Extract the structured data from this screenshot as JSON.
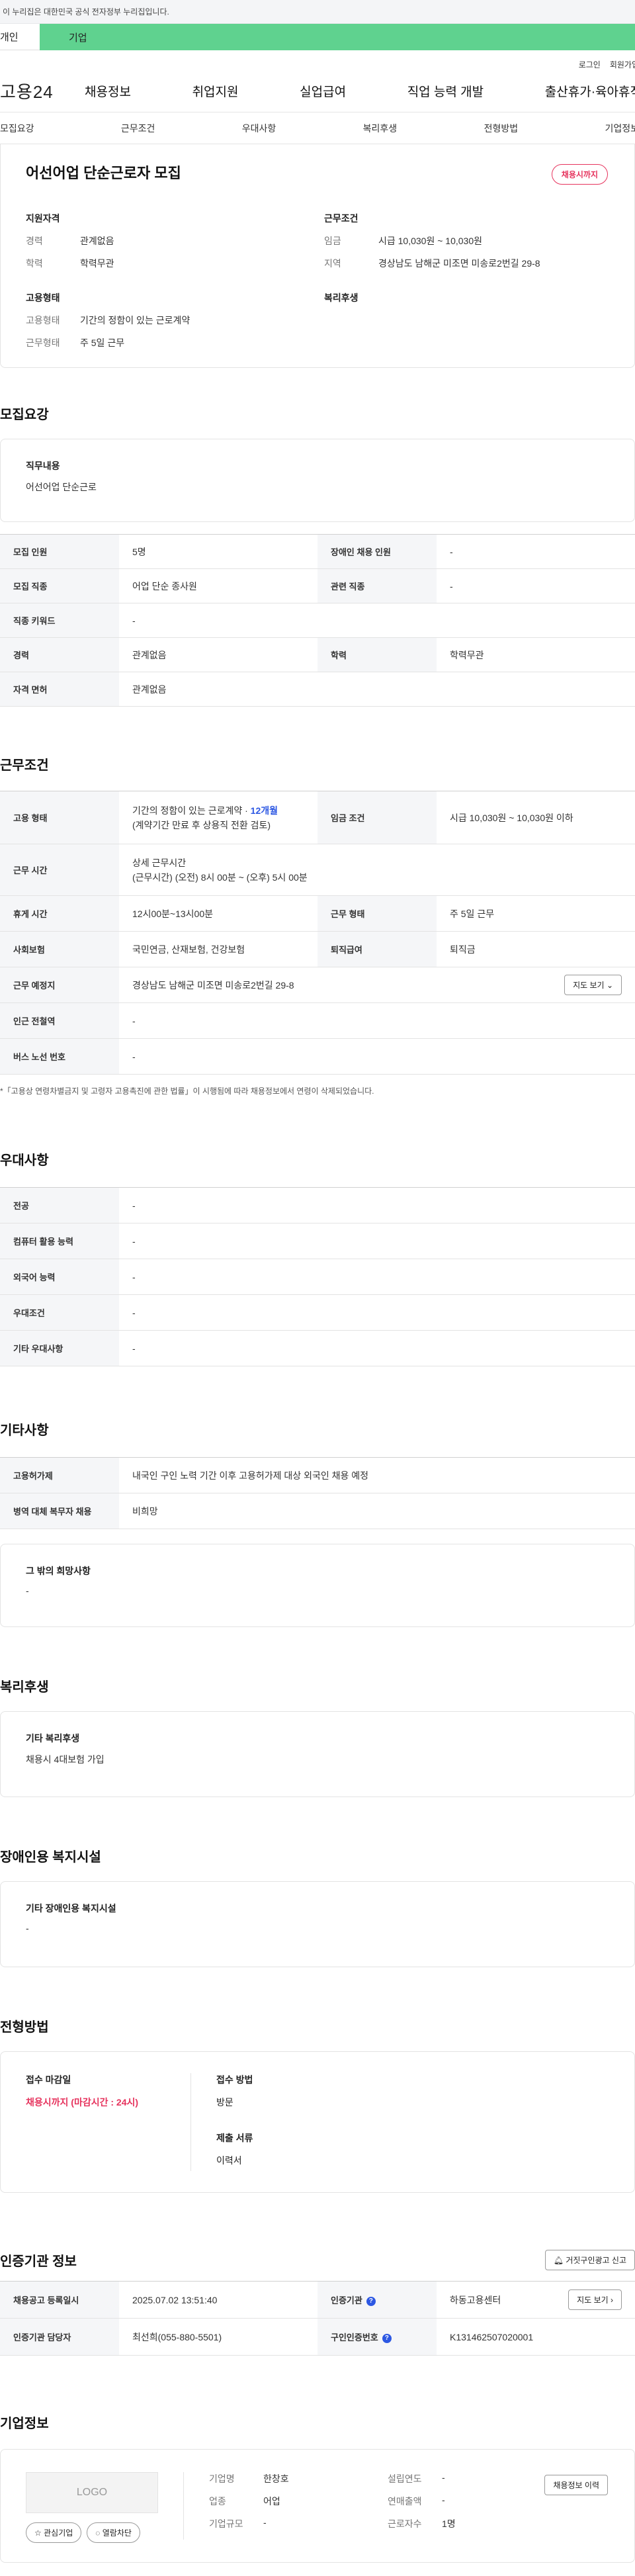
{
  "gov_banner": "이 누리집은 대한민국 공식 전자정부 누리집입니다.",
  "tabs": [
    "개인",
    "기업"
  ],
  "util": [
    "로그인",
    "회원가입"
  ],
  "logo": "고용24",
  "gnb": [
    "채용정보",
    "취업지원",
    "실업급여",
    "직업 능력 개발",
    "출산휴가·육아휴직"
  ],
  "subnav": [
    "모집요강",
    "근무조건",
    "우대사항",
    "복리후생",
    "전형방법",
    "기업정보"
  ],
  "summary": {
    "title": "어선어업 단순근로자 모집",
    "badge": "채용시까지",
    "qual_head": "지원자격",
    "qual": [
      {
        "k": "경력",
        "v": "관계없음"
      },
      {
        "k": "학력",
        "v": "학력무관"
      }
    ],
    "cond_head": "근무조건",
    "cond": [
      {
        "k": "임금",
        "v": "시급 10,030원 ~ 10,030원"
      },
      {
        "k": "지역",
        "v": "경상남도 남해군 미조면 미송로2번길 29-8"
      }
    ],
    "emp_head": "고용형태",
    "emp": [
      {
        "k": "고용형태",
        "v": "기간의 정함이 있는 근로계약"
      },
      {
        "k": "근무형태",
        "v": "주 5일 근무"
      }
    ],
    "welfare_head": "복리후생"
  },
  "recruit": {
    "title": "모집요강",
    "duty_head": "직무내용",
    "duty": "어선어업 단순근로",
    "rows": [
      [
        "모집 인원",
        "5명",
        "장애인 채용 인원",
        "-"
      ],
      [
        "모집 직종",
        "어업 단순 종사원",
        "관련 직종",
        "-"
      ],
      [
        "직종 키워드",
        "-",
        "",
        ""
      ],
      [
        "경력",
        "관계없음",
        "학력",
        "학력무관"
      ],
      [
        "자격 면허",
        "관계없음",
        "",
        ""
      ]
    ]
  },
  "work": {
    "title": "근무조건",
    "emp_type_label": "고용 형태",
    "emp_type_main": "기간의 정함이 있는 근로계약 · ",
    "emp_type_months": "12개월",
    "emp_type_sub": "(계약기간 만료 후 상용직 전환 검토)",
    "wage_label": "임금 조건",
    "wage": "시급 10,030원 ~ 10,030원 이하",
    "hours_label": "근무 시간",
    "hours_head": "상세 근무시간",
    "hours": "(근무시간) (오전) 8시 00분 ~ (오후) 5시 00분",
    "break_label": "휴게 시간",
    "break": "12시00분~13시00분",
    "shift_label": "근무 형태",
    "shift": "주 5일 근무",
    "insurance_label": "사회보험",
    "insurance": "국민연금, 산재보험, 건강보험",
    "retire_label": "퇴직급여",
    "retire": "퇴직금",
    "place_label": "근무 예정지",
    "place": "경상남도 남해군 미조면 미송로2번길 29-8",
    "map_btn": "지도 보기",
    "station_label": "인근 전철역",
    "station": "-",
    "bus_label": "버스 노선 번호",
    "bus": "-",
    "note": "「고용상 연령차별금지 및 고령자 고용촉진에 관한 법률」이 시행됨에 따라 채용정보에서 연령이 삭제되었습니다."
  },
  "pref": {
    "title": "우대사항",
    "rows": [
      [
        "전공",
        "-"
      ],
      [
        "컴퓨터 활용 능력",
        "-"
      ],
      [
        "외국어 능력",
        "-"
      ],
      [
        "우대조건",
        "-"
      ],
      [
        "기타 우대사항",
        "-"
      ]
    ]
  },
  "etc": {
    "title": "기타사항",
    "rows": [
      [
        "고용허가제",
        "내국인 구인 노력 기간 이후 고용허가제 대상 외국인 채용 예정"
      ],
      [
        "병역 대체 복무자 채용",
        "비희망"
      ]
    ],
    "other_head": "그 밖의 희망사항",
    "other": "-"
  },
  "welfare": {
    "title": "복리후생",
    "head": "기타 복리후생",
    "value": "채용시 4대보험 가입"
  },
  "disabled": {
    "title": "장애인용 복지시설",
    "head": "기타 장애인용 복지시설",
    "value": "-"
  },
  "selection": {
    "title": "전형방법",
    "deadline_head": "접수 마감일",
    "deadline": "채용시까지 (마감시간 : 24시)",
    "method_head": "접수 방법",
    "method": "방문",
    "docs_head": "제출 서류",
    "docs": "이력서"
  },
  "cert": {
    "title": "인증기관 정보",
    "report_btn": "거짓구인광고 신고",
    "date_label": "채용공고 등록일시",
    "date": "2025.07.02 13:51:40",
    "org_label": "인증기관",
    "org": "하동고용센터",
    "map_btn": "지도 보기",
    "manager_label": "인증기관 담당자",
    "manager": "최선희(055-880-5501)",
    "num_label": "구인인증번호",
    "num": "K131462507020001"
  },
  "company": {
    "title": "기업정보",
    "logo": "LOGO",
    "fav_btn": "관심기업",
    "block_btn": "열람차단",
    "history_btn": "채용정보 이력",
    "fields": [
      [
        "기업명",
        "한창호"
      ],
      [
        "업종",
        "어업"
      ],
      [
        "기업규모",
        "-"
      ]
    ],
    "fields2": [
      [
        "설립연도",
        "-"
      ],
      [
        "연매출액",
        "-"
      ],
      [
        "근로자수",
        "1명"
      ]
    ]
  }
}
